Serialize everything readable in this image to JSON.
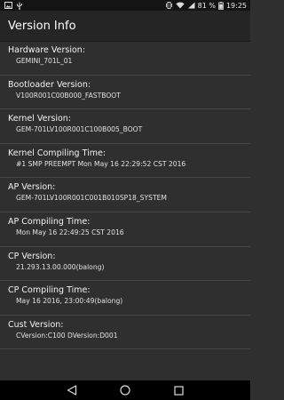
{
  "status_bar": {
    "battery_percent": "81 %",
    "time": "19:25"
  },
  "header": {
    "title": "Version Info"
  },
  "items": [
    {
      "label": "Hardware Version:",
      "value": "GEMINI_701L_01"
    },
    {
      "label": "Bootloader Version:",
      "value": "V100R001C00B000_FASTBOOT"
    },
    {
      "label": "Kernel Version:",
      "value": "GEM-701LV100R001C100B005_BOOT"
    },
    {
      "label": "Kernel Compiling Time:",
      "value": "#1 SMP PREEMPT Mon May 16 22:29:52 CST 2016"
    },
    {
      "label": "AP Version:",
      "value": "GEM-701LV100R001C001B010SP18_SYSTEM"
    },
    {
      "label": "AP Compiling Time:",
      "value": "Mon May 16 22:49:25 CST 2016"
    },
    {
      "label": "CP Version:",
      "value": "21.293.13.00.000(balong)"
    },
    {
      "label": "CP Compiling Time:",
      "value": "May 16 2016, 23:00:49(balong)"
    },
    {
      "label": "Cust Version:",
      "value": "CVersion:C100  DVersion:D001"
    }
  ],
  "icons": {
    "status_left": [
      "photo-icon",
      "usb-icon"
    ],
    "status_right": [
      "vibrate-icon",
      "wifi-icon",
      "signal-icon",
      "battery-icon"
    ],
    "nav": [
      "back-icon",
      "home-icon",
      "recents-icon"
    ]
  }
}
